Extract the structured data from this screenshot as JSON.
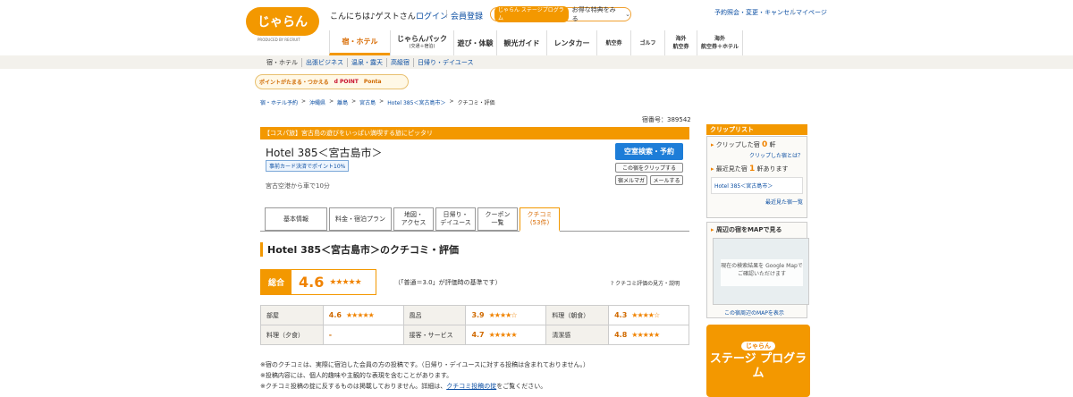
{
  "header": {
    "logo": "じゃらん",
    "logo_sub": "PRODUCED BY RECRUIT",
    "greeting": "こんにちは♪ゲストさん",
    "login": "ログイン",
    "register": "会員登録",
    "stage_program_badge": "じゃらん ステージプログラム",
    "stage_program_text": "お得な特典をみる",
    "top_links": [
      "予約照会・変更・キャンセル",
      "マイページ"
    ]
  },
  "nav": {
    "items": [
      {
        "label": "宿・ホテル",
        "active": true
      },
      {
        "label": "じゃらんパック",
        "sub": "(交通＋宿泊)"
      },
      {
        "label": "遊び・体験"
      },
      {
        "label": "観光ガイド"
      },
      {
        "label": "レンタカー"
      },
      {
        "label": "航空券"
      },
      {
        "label": "ゴルフ"
      },
      {
        "label": "海外",
        "sub": "航空券"
      },
      {
        "label": "海外",
        "sub": "航空券＋ホテル"
      }
    ],
    "subnav": [
      "宿・ホテル",
      "出張ビジネス",
      "温泉・露天",
      "高級宿",
      "日帰り・デイユース"
    ]
  },
  "points": {
    "label": "ポイントがたまる・つかえる",
    "dpoint": "d POINT",
    "ponta": "Ponta"
  },
  "breadcrumb": [
    "宿・ホテル予約",
    "沖縄県",
    "離島",
    "宮古島",
    "Hotel 385＜宮古島市＞",
    "クチコミ・評価"
  ],
  "hotel": {
    "number_label": "宿番号：389542",
    "banner": "【コスパ旅】宮古島の遊びをいっぱい満喫する旅にピッタリ",
    "name": "Hotel 385＜宮古島市＞",
    "badge": "事前カード決済でポイント10%",
    "access": "宮古空港から車で10分",
    "search_button": "空室検索・予約",
    "clip_button": "この宿をクリップする",
    "mail_button": "宿メルマガ",
    "mail_send_button": "メールする"
  },
  "tabs": [
    {
      "label": "基本情報"
    },
    {
      "label": "料金・宿泊プラン"
    },
    {
      "label": "地図・",
      "sub": "アクセス"
    },
    {
      "label": "日帰り・",
      "sub": "デイユース"
    },
    {
      "label": "クーポン",
      "sub": "一覧"
    },
    {
      "label": "クチコミ",
      "sub": "(53件)",
      "active": true
    }
  ],
  "review": {
    "section_title": "Hotel 385＜宮古島市＞のクチコミ・評価",
    "overall_label": "総合",
    "overall_score": "4.6",
    "overall_stars": "★★★★★",
    "baseline_note": "（「普通＝3.0」が評価時の基準です）",
    "help_link": "クチコミ評価の見方・説明",
    "ratings": [
      {
        "label": "部屋",
        "value": "4.6",
        "stars": "★★★★★"
      },
      {
        "label": "風呂",
        "value": "3.9",
        "stars": "★★★★☆"
      },
      {
        "label": "料理（朝食）",
        "value": "4.3",
        "stars": "★★★★☆"
      },
      {
        "label": "料理（夕食）",
        "value": "-",
        "stars": ""
      },
      {
        "label": "接客・サービス",
        "value": "4.7",
        "stars": "★★★★★"
      },
      {
        "label": "清潔感",
        "value": "4.8",
        "stars": "★★★★★"
      }
    ],
    "notes": [
      "※宿のクチコミは、実際に宿泊した会員の方の投稿です。（日帰り・デイユースに対する投稿は含まれておりません。）",
      "※投稿内容には、個人的趣味や主観的な表現を含むことがあります。",
      "※クチコミ投稿の掟に反するものは掲載しておりません。詳細は、"
    ],
    "notes_link": "クチコミ投稿の掟",
    "notes_tail": "をご覧ください。"
  },
  "sidebar": {
    "clip_head": "クリップリスト",
    "clipped_label": "クリップした宿",
    "clipped_count": "0",
    "clipped_unit": "軒",
    "clip_help": "クリップした宿とは？",
    "recent_label": "最近見た宿",
    "recent_count": "1",
    "recent_unit": "軒あります",
    "recent_item": "Hotel 385＜宮古島市＞",
    "recent_link": "最近見た宿一覧",
    "map_title": "周辺の宿をMAPで見る",
    "map_text": "現在の検索結果を Google Mapで ご確認いただけます",
    "map_link": "この宿周辺のMAPを表示",
    "stage_badge": "じゃらん",
    "stage_text": "ステージ プログラム"
  },
  "colors": {
    "brand_orange": "#f39800",
    "link_blue": "#0b4ea2",
    "button_blue": "#1d7dd8"
  }
}
